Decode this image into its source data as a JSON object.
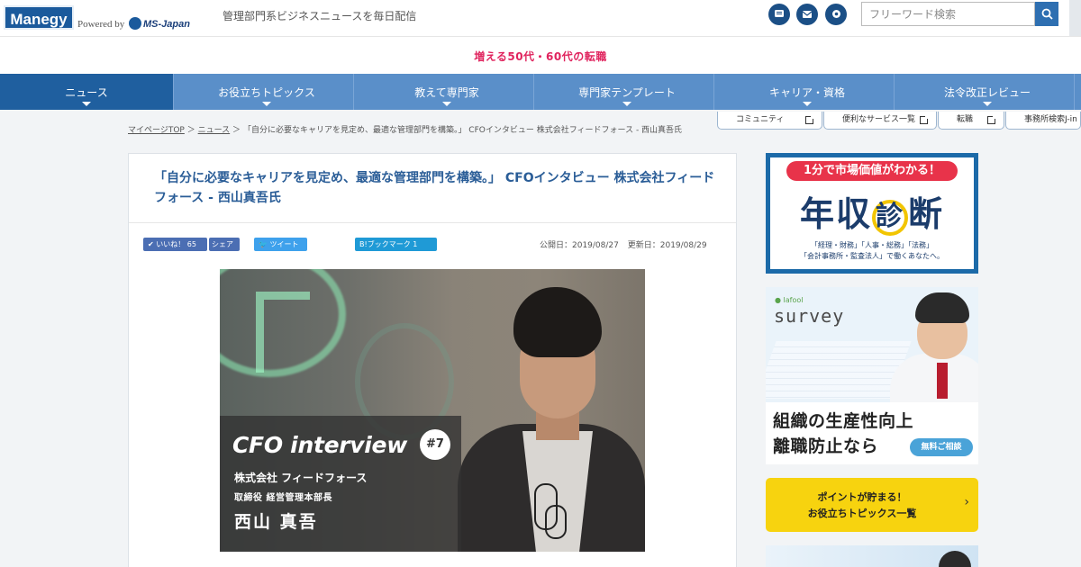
{
  "header": {
    "logo": "Manegy",
    "powered_by": "Powered by",
    "partner": "MS-Japan",
    "tagline": "管理部門系ビジネスニュースを毎日配信",
    "search_placeholder": "フリーワード検索",
    "icons": [
      "chat-icon",
      "mail-icon",
      "gear-icon",
      "search-icon"
    ]
  },
  "promo": {
    "text": "増える50代・60代の転職"
  },
  "nav": {
    "items": [
      {
        "label": "ニュース",
        "active": true
      },
      {
        "label": "お役立ちトピックス"
      },
      {
        "label": "教えて専門家"
      },
      {
        "label": "専門家テンプレート"
      },
      {
        "label": "キャリア・資格"
      },
      {
        "label": "法令改正レビュー"
      }
    ]
  },
  "breadcrumb": {
    "home": "マイページTOP",
    "sep": "＞",
    "section": "ニュース",
    "current": "「自分に必要なキャリアを見定め、最適な管理部門を構築。」 CFOインタビュー 株式会社フィードフォース - 西山真吾氏"
  },
  "pills": [
    "コミュニティ",
    "便利なサービス一覧",
    "転職",
    "事務所検索J-in"
  ],
  "article": {
    "title": "「自分に必要なキャリアを見定め、最適な管理部門を構築。」 CFOインタビュー 株式会社フィードフォース - 西山真吾氏",
    "share": {
      "like": "いいね！ 65",
      "share": "シェア",
      "tweet": "ツイート",
      "hatena": "B!ブックマーク 1"
    },
    "published": "公開日：2019/08/27",
    "updated": "更新日：2019/08/29",
    "hero": {
      "title": "CFO interview",
      "badge": "#7",
      "company": "株式会社 フィードフォース",
      "role": "取締役 経営管理本部長",
      "name": "西山 真吾"
    }
  },
  "sidebar": {
    "ad1": {
      "top": "1分で市場価値がわかる！",
      "main_a": "年収",
      "main_b": "診",
      "main_c": "断",
      "sub1": "「経理・財務」「人事・総務」「法務」",
      "sub2": "「会計事務所・監査法人」で働くあなたへ。"
    },
    "ad2": {
      "brand": "● lafool",
      "survey": "survey",
      "line1": "組織の生産性向上",
      "line2": "離職防止なら",
      "cta": "無料ご相談"
    },
    "points": {
      "line1": "ポイントが貯まる！",
      "line2": "お役立ちトピックス一覧",
      "chevron": "›"
    }
  }
}
